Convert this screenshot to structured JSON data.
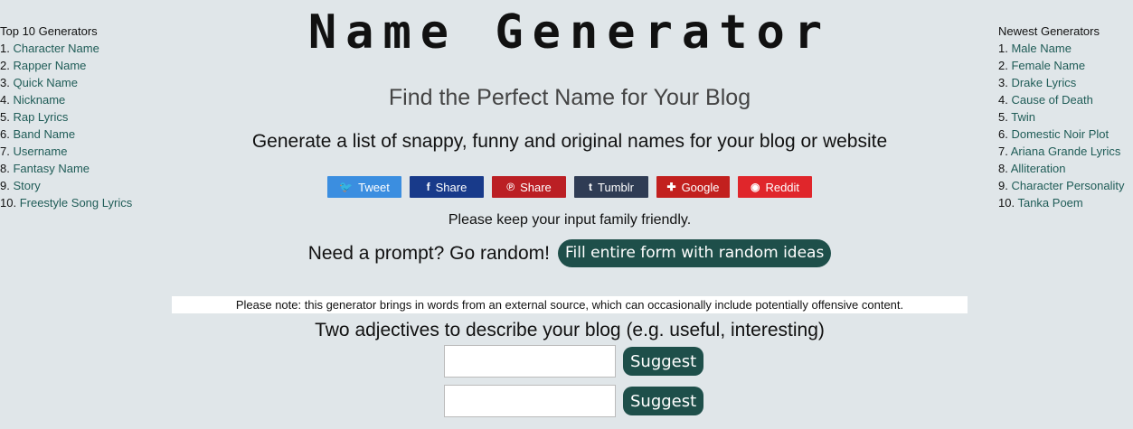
{
  "top_list": {
    "heading": "Top 10 Generators",
    "items": [
      {
        "num": "1.",
        "label": "Character Name"
      },
      {
        "num": "2.",
        "label": "Rapper Name"
      },
      {
        "num": "3.",
        "label": "Quick Name"
      },
      {
        "num": "4.",
        "label": "Nickname"
      },
      {
        "num": "5.",
        "label": "Rap Lyrics"
      },
      {
        "num": "6.",
        "label": "Band Name"
      },
      {
        "num": "7.",
        "label": "Username"
      },
      {
        "num": "8.",
        "label": "Fantasy Name"
      },
      {
        "num": "9.",
        "label": "Story"
      },
      {
        "num": "10.",
        "label": "Freestyle Song Lyrics"
      }
    ]
  },
  "newest_list": {
    "heading": "Newest Generators",
    "items": [
      {
        "num": "1.",
        "label": "Male Name"
      },
      {
        "num": "2.",
        "label": "Female Name"
      },
      {
        "num": "3.",
        "label": "Drake Lyrics"
      },
      {
        "num": "4.",
        "label": "Cause of Death"
      },
      {
        "num": "5.",
        "label": "Twin"
      },
      {
        "num": "6.",
        "label": "Domestic Noir Plot"
      },
      {
        "num": "7.",
        "label": "Ariana Grande Lyrics"
      },
      {
        "num": "8.",
        "label": "Alliteration"
      },
      {
        "num": "9.",
        "label": "Character Personality"
      },
      {
        "num": "10.",
        "label": "Tanka Poem"
      }
    ]
  },
  "header": {
    "logo": "Name Generator",
    "subtitle": "Find the Perfect Name for Your Blog",
    "tagline": "Generate a list of snappy, funny and original names for your blog or website"
  },
  "share": [
    {
      "label": "Tweet",
      "icon": "twitter-icon",
      "glyph": "🐦",
      "color": "#3b8ee0"
    },
    {
      "label": "Share",
      "icon": "facebook-icon",
      "glyph": "f",
      "color": "#183a8a"
    },
    {
      "label": "Share",
      "icon": "pinterest-icon",
      "glyph": "℗",
      "color": "#bb1f24"
    },
    {
      "label": "Tumblr",
      "icon": "tumblr-icon",
      "glyph": "t",
      "color": "#2f3c54"
    },
    {
      "label": "Google",
      "icon": "google-plus-icon",
      "glyph": "✚",
      "color": "#c2201e"
    },
    {
      "label": "Reddit",
      "icon": "reddit-icon",
      "glyph": "◉",
      "color": "#e0262b"
    }
  ],
  "friendly_text": "Please keep your input family friendly.",
  "prompt": {
    "text": "Need a prompt? Go random!",
    "button": "Fill entire form with random ideas"
  },
  "note": "Please note: this generator brings in words from an external source, which can occasionally include potentially offensive content.",
  "question": "Two adjectives to describe your blog (e.g. useful, interesting)",
  "fields": [
    {
      "value": "",
      "button": "Suggest"
    },
    {
      "value": "",
      "button": "Suggest"
    }
  ],
  "colors": {
    "background": "#e0e6e9",
    "link": "#1f5c57",
    "accent_button": "#1e4f4a"
  }
}
